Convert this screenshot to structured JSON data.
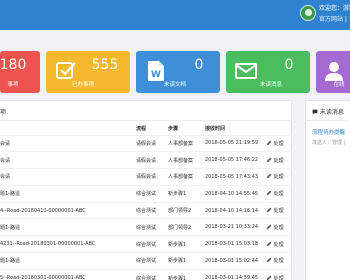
{
  "header": {
    "welcome": "欢迎您：游戏",
    "official_site": "官方网站 |"
  },
  "cards": [
    {
      "value": "180",
      "label": "事项",
      "color": "#ef5350"
    },
    {
      "value": "555",
      "label": "已办事项",
      "color": "#f5b82e",
      "icon": "check-square-icon"
    },
    {
      "value": "0",
      "label": "未读文档",
      "color": "#3f8ed8",
      "icon": "word-document-icon"
    },
    {
      "value": "0",
      "label": "未读消息",
      "color": "#4bbd5f",
      "icon": "envelope-icon"
    },
    {
      "label": "在线",
      "color": "#a56ad1",
      "icon": "user-icon"
    }
  ],
  "todo": {
    "title": "项",
    "columns": [
      "",
      "流程",
      "步骤",
      "接收时间",
      ""
    ],
    "rows": [
      {
        "title": "会请",
        "flow": "请假会请",
        "step": "人事部备案",
        "time": "2018-05-05 21:19:59",
        "action": "处理"
      },
      {
        "title": "会请",
        "flow": "请假会请",
        "step": "人事部备案",
        "time": "2018-05-05 17:46:22",
        "action": "处理"
      },
      {
        "title": "会请",
        "flow": "请假会请",
        "step": "人事部备案",
        "time": "2018-05-05 17:43:43",
        "action": "处理"
      },
      {
        "title": "题1-路遥",
        "flow": "综合测试",
        "step": "新步骤1",
        "time": "2018-04-10 14:55:45",
        "action": "处理"
      },
      {
        "title": "4--Road-20180410-00000001-ABC",
        "flow": "综合测试",
        "step": "部门领导2",
        "time": "2018-04-10 14:16:14",
        "action": "处理"
      },
      {
        "title": "题1-路遥",
        "flow": "综合测试",
        "step": "部门领导2",
        "time": "2018-03-21 10:33:24",
        "action": "处理"
      },
      {
        "title": "4231--Road-20180301-00000001-ABC",
        "flow": "综合测试",
        "step": "新步骤1",
        "time": "2018-03-01 15:03:18",
        "action": "处理"
      },
      {
        "title": "题1-路遥",
        "flow": "综合测试",
        "step": "新步骤1",
        "time": "2018-03-01 15:02:44",
        "action": "处理"
      },
      {
        "title": "5--Road-20180301-00000001-ABC",
        "flow": "综合测试",
        "step": "新步骤1",
        "time": "2018-03-01 14:59:45",
        "action": "处理"
      }
    ]
  },
  "messages": {
    "title": "未读消息",
    "item_title": "流程待办提醒",
    "item_sub": "发送人：管理 |"
  }
}
